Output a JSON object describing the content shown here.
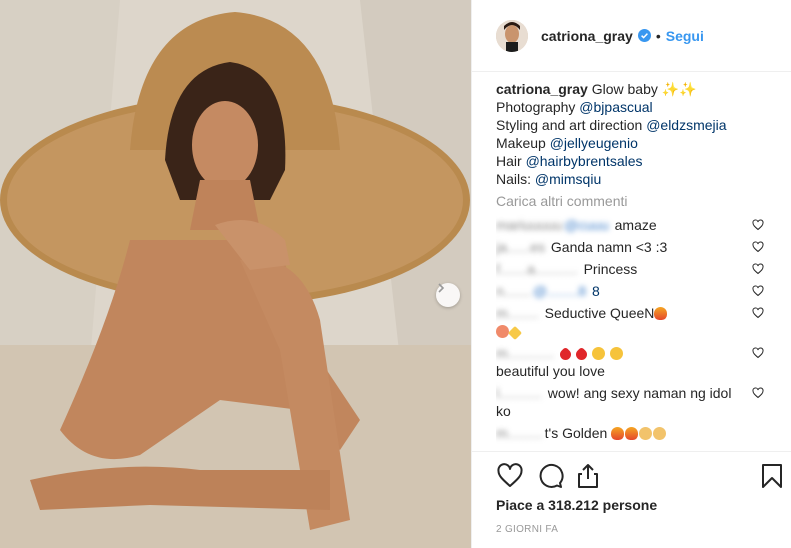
{
  "post": {
    "username": "catriona_gray",
    "follow_label": "Segui",
    "separator": "•",
    "caption": {
      "text": "Glow baby ✨✨",
      "lines": [
        {
          "prefix": "Photography ",
          "mention": "@bjpascual"
        },
        {
          "prefix": "Styling and art direction ",
          "mention": "@eldzsmejia"
        },
        {
          "prefix": "Makeup ",
          "mention": "@jellyeugenio"
        },
        {
          "prefix": "Hair ",
          "mention": "@hairbybrentsales"
        },
        {
          "prefix": "Nails: ",
          "mention": "@mimsqiu"
        }
      ]
    },
    "load_more_label": "Carica altri commenti",
    "comments": [
      {
        "user": "mariuuuuu",
        "blurred_extra": "@cuuu",
        "text": "amaze"
      },
      {
        "user": "ja......es",
        "text": "Ganda namn <3 :3"
      },
      {
        "user": "f.......a...........",
        "text": "Princess"
      },
      {
        "user": "n.......",
        "blurred_extra": "@........8",
        "text": "8"
      },
      {
        "user": "m........",
        "text": "Seductive QueeN"
      },
      {
        "user": "m............",
        "text": ""
      },
      {
        "user": "",
        "text": "beautiful you love"
      },
      {
        "user": "l...........",
        "text": "wow! ang sexy naman ng idol ko"
      },
      {
        "user": "m.........",
        "text": "t's Golden"
      }
    ],
    "likes_label": "Piace a 318.212 persone",
    "timestamp": "2 GIORNI FA"
  },
  "colors": {
    "link": "#3897f0",
    "mention": "#003569",
    "muted": "#999999",
    "text": "#262626"
  },
  "icons": [
    "verified-badge-icon",
    "heart-icon",
    "comment-icon",
    "share-icon",
    "bookmark-icon",
    "chevron-right-icon"
  ]
}
